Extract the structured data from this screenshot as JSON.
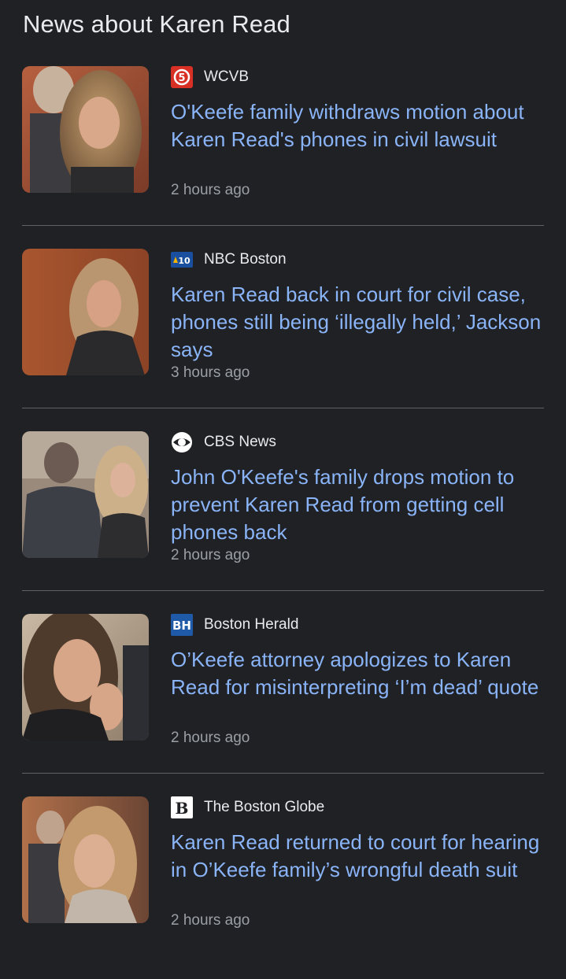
{
  "section": {
    "title": "News about Karen Read"
  },
  "articles": [
    {
      "source": "WCVB",
      "source_logo": "wcvb-channel-5-logo",
      "headline": "O'Keefe family withdraws motion about Karen Read's phones in civil lawsuit",
      "time": "2 hours ago",
      "thumbnail": "photo-woman-blonde-courtroom-man-behind"
    },
    {
      "source": "NBC Boston",
      "source_logo": "nbc-boston-10-logo",
      "headline": "Karen Read back in court for civil case, phones still being ‘illegally held,’ Jackson says",
      "time": "3 hours ago",
      "thumbnail": "photo-woman-blonde-courtroom-wood-wall"
    },
    {
      "source": "CBS News",
      "source_logo": "cbs-eye-logo",
      "headline": "John O'Keefe's family drops motion to prevent Karen Read from getting cell phones back",
      "time": "2 hours ago",
      "thumbnail": "photo-man-suit-and-woman-courtroom"
    },
    {
      "source": "Boston Herald",
      "source_logo": "boston-herald-bh-logo",
      "headline": "O’Keefe attorney apologizes to Karen Read for misinterpreting ‘I’m dead’ quote",
      "time": "2 hours ago",
      "thumbnail": "photo-woman-hand-on-chin-courtroom"
    },
    {
      "source": "The Boston Globe",
      "source_logo": "boston-globe-logo",
      "headline": "Karen Read returned to court for hearing in O’Keefe family’s wrongful death suit",
      "time": "2 hours ago",
      "thumbnail": "photo-woman-smiling-courtroom-crowd"
    }
  ],
  "colors": {
    "background": "#202124",
    "headline_link": "#8ab4f8",
    "timestamp": "#9aa0a6",
    "divider": "#5f6368"
  }
}
